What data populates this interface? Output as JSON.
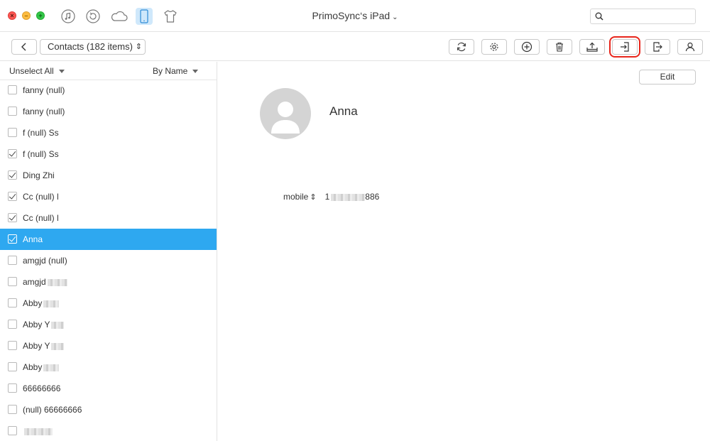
{
  "window": {
    "title": "PrimoSync‘s iPad",
    "title_chevron": "⌄",
    "search_placeholder": ""
  },
  "nav_icons": [
    "music-icon",
    "restore-icon",
    "cloud-icon",
    "ipad-icon",
    "tshirt-icon"
  ],
  "toolbar": {
    "category_label": "Contacts (182 items)",
    "updown_glyph": "⇕",
    "buttons": [
      "refresh-button",
      "settings-button",
      "add-button",
      "delete-button",
      "export-to-computer-button",
      "import-button",
      "transfer-to-device-button",
      "merge-contacts-button"
    ],
    "highlighted_button": "import-button",
    "highlight_color": "#e8261c"
  },
  "sidebar": {
    "unselect_all": "Unselect All",
    "sort_label": "By Name",
    "items": [
      {
        "label": "fanny (null)",
        "checked": false,
        "selected": false
      },
      {
        "label": "fanny (null)",
        "checked": false,
        "selected": false
      },
      {
        "label": "f (null) Ss",
        "checked": false,
        "selected": false
      },
      {
        "label": "f (null) Ss",
        "checked": true,
        "selected": false
      },
      {
        "label": "Ding Zhi",
        "checked": true,
        "selected": false
      },
      {
        "label": "Cc (null) l",
        "checked": true,
        "selected": false
      },
      {
        "label": "Cc (null) l",
        "checked": true,
        "selected": false
      },
      {
        "label": "Anna",
        "checked": true,
        "selected": true
      },
      {
        "label": "amgjd (null)",
        "checked": false,
        "selected": false
      },
      {
        "label": "amgjd",
        "checked": false,
        "selected": false
      },
      {
        "label": "Abby",
        "checked": false,
        "selected": false
      },
      {
        "label": "Abby Y",
        "checked": false,
        "selected": false
      },
      {
        "label": "Abby Y",
        "checked": false,
        "selected": false
      },
      {
        "label": "Abby",
        "checked": false,
        "selected": false
      },
      {
        "label": "66666666",
        "checked": false,
        "selected": false
      },
      {
        "label": "(null) 66666666",
        "checked": false,
        "selected": false
      },
      {
        "label": "",
        "checked": false,
        "selected": false
      }
    ],
    "selected_color": "#2ea8f0"
  },
  "detail": {
    "edit_label": "Edit",
    "contact_name": "Anna",
    "phone_type": "mobile",
    "phone_type_glyph": "⇕",
    "phone_number_prefix": "1",
    "phone_number_suffix": "886"
  }
}
